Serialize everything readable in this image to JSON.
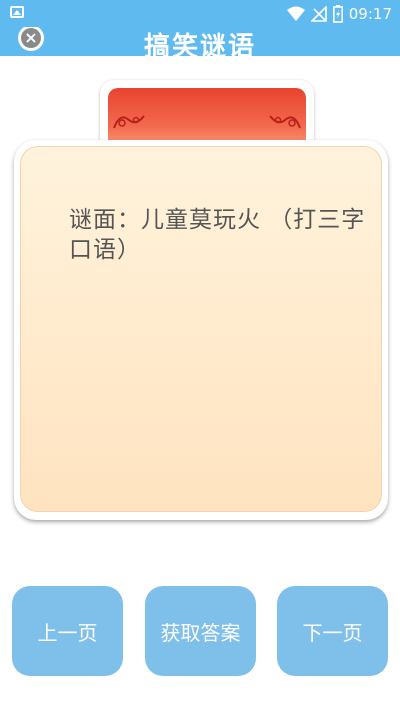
{
  "status_bar": {
    "time": "09:17",
    "icons": [
      "image-icon",
      "wifi-icon",
      "no-signal-icon",
      "battery-icon"
    ]
  },
  "header": {
    "title": "搞笑谜语",
    "close_icon": "close-icon"
  },
  "riddle": {
    "text": "谜面：儿童莫玩火 （打三字口语）"
  },
  "buttons": {
    "prev": "上一页",
    "answer": "获取答案",
    "next": "下一页"
  },
  "colors": {
    "header_bg": "#5fbaf0",
    "button_bg": "#7fc0ea",
    "card_bg": "#fff3dc",
    "tab_red": "#e8432f"
  }
}
